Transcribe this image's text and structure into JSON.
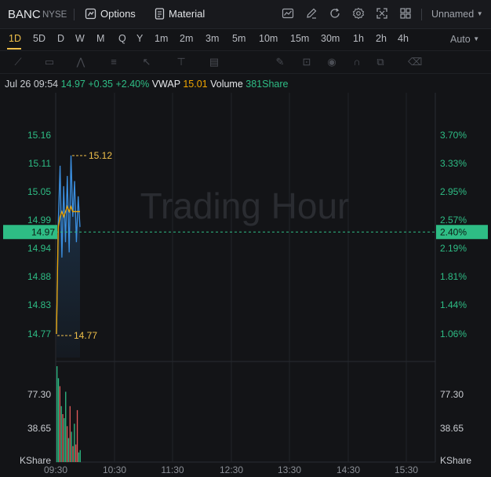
{
  "header": {
    "symbol": "BANC",
    "exchange": "NYSE",
    "options_label": "Options",
    "material_label": "Material",
    "layout_name": "Unnamed",
    "icons": [
      "chart-type-icon",
      "draw-icon",
      "refresh-icon",
      "settings-icon",
      "fullscreen-icon",
      "layout-grid-icon"
    ]
  },
  "timeframes": [
    "1D",
    "5D",
    "D",
    "W",
    "M",
    "Q",
    "Y",
    "1m",
    "2m",
    "3m",
    "5m",
    "10m",
    "15m",
    "30m",
    "1h",
    "2h",
    "4h"
  ],
  "active_timeframe": "1D",
  "scale_mode": "Auto",
  "draw_tools": [
    "line-tool-icon",
    "rect-tool-icon",
    "pattern-tool-icon",
    "fib-tool-icon",
    "arrow-tool-icon",
    "text-tool-icon",
    "note-tool-icon",
    "pen-tool-icon",
    "lock-icon",
    "eye-icon",
    "magnet-icon",
    "group-icon",
    "trash-icon"
  ],
  "quote": {
    "time": "Jul 26 09:54",
    "price": "14.97",
    "change": "+0.35",
    "change_pct": "+2.40%",
    "vwap_label": "VWAP",
    "vwap_value": "15.01",
    "volume_label": "Volume",
    "volume_value": "381Share"
  },
  "watermark": "Trading Hour",
  "colors": {
    "up": "#2ebd85",
    "down": "#e45a5a",
    "price_line": "#3b8fe0",
    "vwap_line": "#f0a500",
    "accent": "#f0c04a",
    "current_price_bg": "#2ebd85"
  },
  "chart_data": {
    "type": "line",
    "price_axis_left": [
      "15.16",
      "15.11",
      "15.05",
      "14.99",
      "14.94",
      "14.88",
      "14.83",
      "14.77"
    ],
    "price_axis_right": [
      "3.70%",
      "3.33%",
      "2.95%",
      "2.57%",
      "2.19%",
      "1.81%",
      "1.44%",
      "1.06%"
    ],
    "current_price": "14.97",
    "current_pct": "2.40%",
    "high_label": "15.12",
    "low_label": "14.77",
    "x_ticks": [
      "09:30",
      "10:30",
      "11:30",
      "12:30",
      "13:30",
      "14:30",
      "15:30"
    ],
    "price_series": [
      14.77,
      14.99,
      15.1,
      14.92,
      15.06,
      14.95,
      15.08,
      14.93,
      15.12,
      15.0,
      15.07,
      14.95,
      15.04,
      14.98
    ],
    "vwap_series": [
      14.77,
      14.98,
      15.0,
      15.01,
      15.0,
      15.01,
      15.02,
      15.01,
      15.02,
      15.01,
      15.01,
      15.01,
      15.01,
      15.01
    ],
    "volume_axis": [
      "77.30",
      "38.65"
    ],
    "volume_unit": "KShare",
    "volume_bars": [
      {
        "v": 120,
        "dir": "up"
      },
      {
        "v": 105,
        "dir": "up"
      },
      {
        "v": 95,
        "dir": "down"
      },
      {
        "v": 70,
        "dir": "up"
      },
      {
        "v": 60,
        "dir": "down"
      },
      {
        "v": 55,
        "dir": "up"
      },
      {
        "v": 88,
        "dir": "up"
      },
      {
        "v": 45,
        "dir": "down"
      },
      {
        "v": 30,
        "dir": "up"
      },
      {
        "v": 70,
        "dir": "down"
      },
      {
        "v": 38,
        "dir": "up"
      },
      {
        "v": 20,
        "dir": "down"
      },
      {
        "v": 48,
        "dir": "up"
      },
      {
        "v": 22,
        "dir": "down"
      },
      {
        "v": 65,
        "dir": "down"
      },
      {
        "v": 12,
        "dir": "up"
      },
      {
        "v": 15,
        "dir": "up"
      }
    ]
  }
}
